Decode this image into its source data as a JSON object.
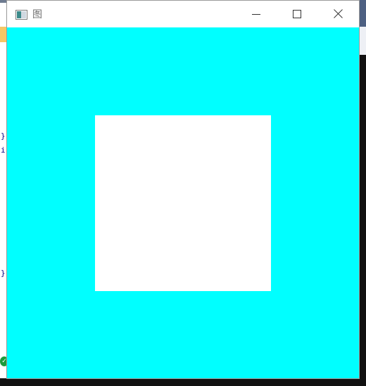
{
  "background": {
    "code_chars": [
      "}",
      "i",
      "}"
    ],
    "status_icon": "check-circle-icon"
  },
  "window": {
    "title": "图",
    "icon": "application-window-icon",
    "controls": {
      "minimize_icon": "minimize-icon",
      "maximize_icon": "maximize-icon",
      "close_icon": "close-icon"
    }
  },
  "canvas": {
    "background_color": "#00ffff",
    "shape_color": "#ffffff",
    "shape": "white-square"
  }
}
